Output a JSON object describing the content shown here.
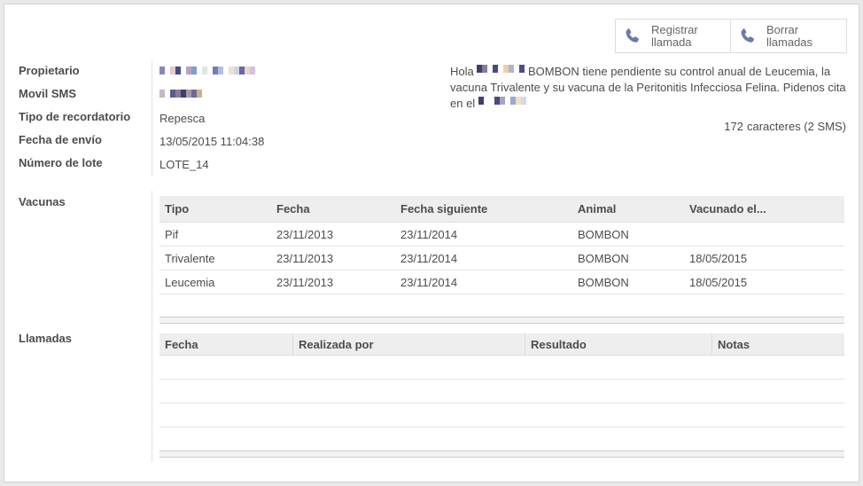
{
  "toolbar": {
    "register_call": "Registrar llamada",
    "register_call_l1": "Registrar",
    "register_call_l2": "llamada",
    "clear_calls": "Borrar llamadas",
    "clear_calls_l1": "Borrar",
    "clear_calls_l2": "llamadas",
    "icon": "phone-icon"
  },
  "fields": {
    "owner_label": "Propietario",
    "mobile_label": "Movil SMS",
    "reminder_type_label": "Tipo de recordatorio",
    "reminder_type": "Repesca",
    "send_date_label": "Fecha de envío",
    "send_date": "13/05/2015 11:04:38",
    "batch_label": "Número de lote",
    "batch": "LOTE_14"
  },
  "sms": {
    "hello": "Hola",
    "text1": "BOMBON tiene pendiente su control anual de Leucemia, la vacuna Trivalente y su vacuna de la Peritonitis Infecciosa Felina. Pidenos cita en el",
    "char_count": "172",
    "chars_text": "caracteres (",
    "sms_count": "2",
    "sms_text": " SMS)"
  },
  "vaccines": {
    "label": "Vacunas",
    "columns": [
      "Tipo",
      "Fecha",
      "Fecha siguiente",
      "Animal",
      "Vacunado el..."
    ],
    "rows": [
      [
        "Pif",
        "23/11/2013",
        "23/11/2014",
        "BOMBON",
        ""
      ],
      [
        "Trivalente",
        "23/11/2013",
        "23/11/2014",
        "BOMBON",
        "18/05/2015"
      ],
      [
        "Leucemia",
        "23/11/2013",
        "23/11/2014",
        "BOMBON",
        "18/05/2015"
      ]
    ]
  },
  "calls": {
    "label": "Llamadas",
    "columns": [
      "Fecha",
      "Realizada por",
      "Resultado",
      "Notas"
    ]
  }
}
